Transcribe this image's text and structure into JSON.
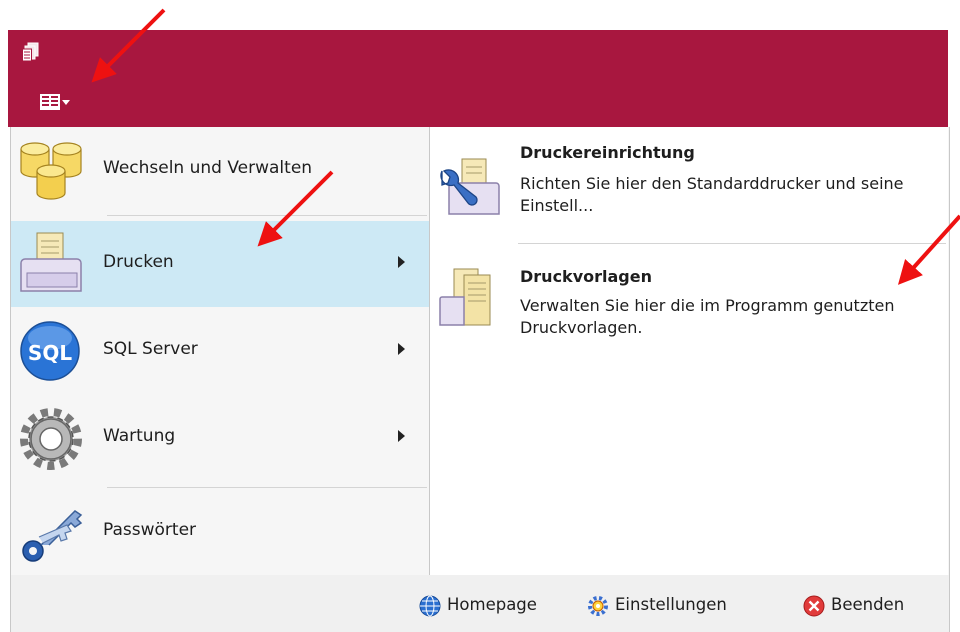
{
  "left_menu": {
    "items": [
      {
        "label": "Wechseln und Verwalten",
        "icon": "database-icon"
      },
      {
        "label": "Drucken",
        "icon": "printer-icon"
      },
      {
        "label": "SQL Server",
        "icon": "sql-icon"
      },
      {
        "label": "Wartung",
        "icon": "gear-icon"
      },
      {
        "label": "Passwörter",
        "icon": "keys-icon"
      }
    ]
  },
  "right_pane": {
    "items": [
      {
        "title": "Druckereinrichtung",
        "description": "Richten Sie hier den Standarddrucker und seine Einstell...",
        "icon": "printer-wrench-icon"
      },
      {
        "title": "Druckvorlagen",
        "description": "Verwalten Sie hier die im Programm genutzten Druckvorlagen.",
        "icon": "print-templates-icon"
      }
    ]
  },
  "bottom_bar": {
    "homepage": "Homepage",
    "settings": "Einstellungen",
    "exit": "Beenden"
  },
  "colors": {
    "titlebar": "#a8173f",
    "active_item": "#cde9f5",
    "annotation_arrow": "#ee1111"
  }
}
